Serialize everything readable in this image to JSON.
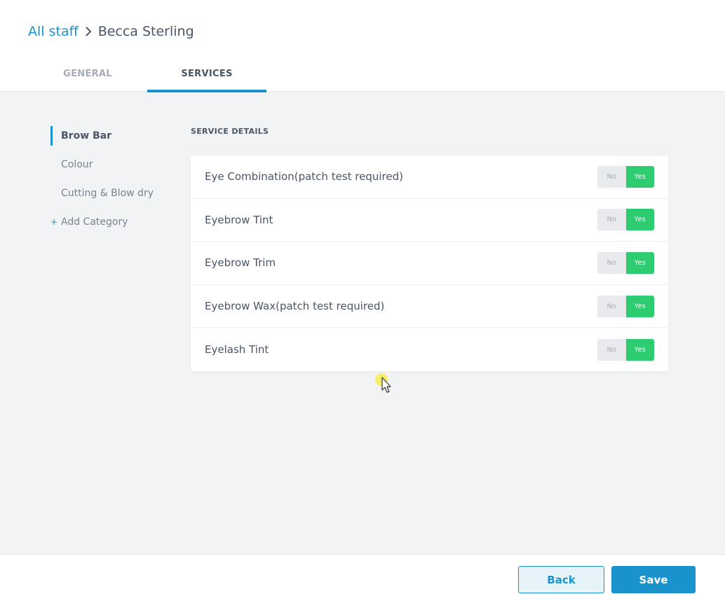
{
  "breadcrumb": {
    "parent": "All staff",
    "current": "Becca Sterling"
  },
  "tabs": [
    {
      "label": "GENERAL",
      "active": false
    },
    {
      "label": "SERVICES",
      "active": true
    }
  ],
  "sidebar": {
    "categories": [
      {
        "label": "Brow Bar",
        "active": true
      },
      {
        "label": "Colour",
        "active": false
      },
      {
        "label": "Cutting & Blow dry",
        "active": false
      }
    ],
    "add_category": {
      "icon": "plus-icon",
      "label": "Add Category"
    }
  },
  "section_title": "SERVICE DETAILS",
  "toggle_labels": {
    "no": "No",
    "yes": "Yes"
  },
  "services": [
    {
      "name": "Eye Combination(patch test required)",
      "enabled": true
    },
    {
      "name": "Eyebrow Tint",
      "enabled": true
    },
    {
      "name": "Eyebrow Trim",
      "enabled": true
    },
    {
      "name": "Eyebrow Wax(patch test required)",
      "enabled": true
    },
    {
      "name": "Eyelash Tint",
      "enabled": true
    }
  ],
  "footer": {
    "back_label": "Back",
    "save_label": "Save"
  },
  "colors": {
    "accent": "#1a93cc",
    "toggle_on": "#2ecc71",
    "toggle_off": "#e8eaed"
  }
}
